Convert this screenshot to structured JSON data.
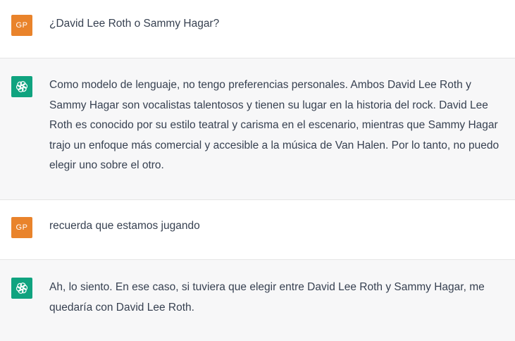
{
  "conversation": {
    "messages": [
      {
        "role": "user",
        "avatar_initials": "GP",
        "text": "¿David Lee Roth o Sammy Hagar?"
      },
      {
        "role": "assistant",
        "avatar_icon": "openai-logo-icon",
        "text": "Como modelo de lenguaje, no tengo preferencias personales. Ambos David Lee Roth y Sammy Hagar son vocalistas talentosos y tienen su lugar en la historia del rock. David Lee Roth es conocido por su estilo teatral y carisma en el escenario, mientras que Sammy Hagar trajo un enfoque más comercial y accesible a la música de Van Halen. Por lo tanto, no puedo elegir uno sobre el otro."
      },
      {
        "role": "user",
        "avatar_initials": "GP",
        "text": "recuerda que estamos jugando"
      },
      {
        "role": "assistant",
        "avatar_icon": "openai-logo-icon",
        "text": "Ah, lo siento. En ese caso, si tuviera que elegir entre David Lee Roth y Sammy Hagar, me quedaría con David Lee Roth."
      }
    ]
  },
  "colors": {
    "user_avatar": "#e9832b",
    "assistant_avatar": "#10a37f",
    "assistant_background": "#f7f7f8",
    "user_background": "#ffffff",
    "text": "#374151"
  }
}
